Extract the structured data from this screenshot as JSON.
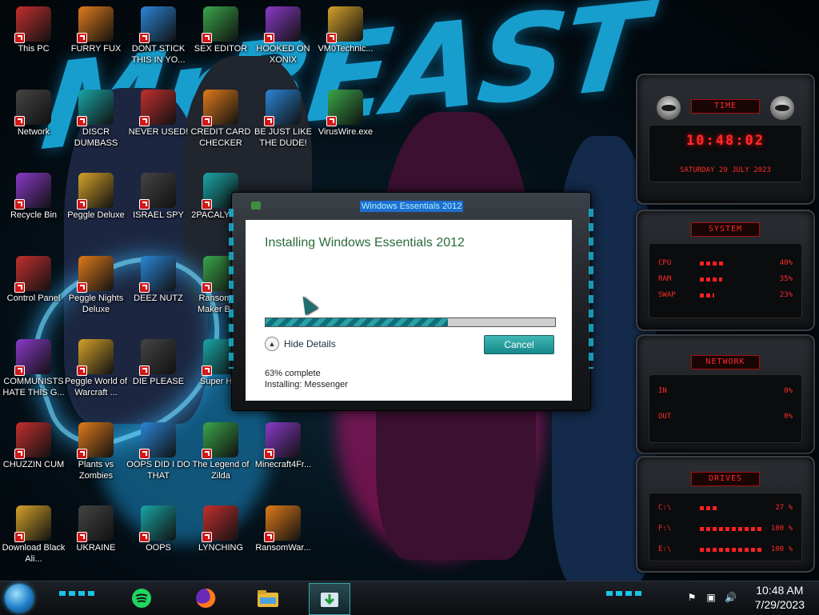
{
  "desktop": {
    "icons": [
      {
        "label": "This PC"
      },
      {
        "label": "FURRY FUX"
      },
      {
        "label": "DONT STICK THIS IN YO..."
      },
      {
        "label": "SEX EDITOR"
      },
      {
        "label": "HOOKED ON XONIX"
      },
      {
        "label": "VM0Technic..."
      },
      {
        "label": "Network"
      },
      {
        "label": "DISCR DUMBASS"
      },
      {
        "label": "NEVER USED!"
      },
      {
        "label": "CREDIT CARD CHECKER"
      },
      {
        "label": "BE JUST LIKE THE DUDE!"
      },
      {
        "label": "VirusWire.exe"
      },
      {
        "label": "Recycle Bin"
      },
      {
        "label": "Peggle Deluxe"
      },
      {
        "label": "ISRAEL SPY"
      },
      {
        "label": "2PACALYP 2.3"
      },
      {
        "label": "Control Panel"
      },
      {
        "label": "Peggle Nights Deluxe"
      },
      {
        "label": "DEEZ NUTZ"
      },
      {
        "label": "Ransomwa Maker Build"
      },
      {
        "label": "COMMUNISTS HATE THIS G..."
      },
      {
        "label": "Peggle World of Warcraft ..."
      },
      {
        "label": "DIE PLEASE"
      },
      {
        "label": "Super Hi..."
      },
      {
        "label": "CHUZZIN CUM"
      },
      {
        "label": "Plants vs Zombies"
      },
      {
        "label": "OOPS DID I DO THAT"
      },
      {
        "label": "The Legend of Zilda"
      },
      {
        "label": "Minecraft4Fr..."
      },
      {
        "label": "Download Black Ali..."
      },
      {
        "label": "UKRAINE"
      },
      {
        "label": "OOPS"
      },
      {
        "label": "LYNCHING"
      },
      {
        "label": "RansomWar..."
      }
    ]
  },
  "installer": {
    "title": "Windows Essentials 2012",
    "heading": "Installing Windows Essentials 2012",
    "progress_fraction": 0.63,
    "hide_details_label": "Hide Details",
    "cancel_label": "Cancel",
    "status_percent": "63% complete",
    "status_item": "Installing: Messenger"
  },
  "gadgets": {
    "clock": {
      "header": "TIME",
      "time": "10:48:02",
      "date": "SATURDAY 29 JULY 2023"
    },
    "system": {
      "header": "SYSTEM",
      "rows": [
        {
          "name": "CPU",
          "value": "40%",
          "fraction": 0.4
        },
        {
          "name": "RAM",
          "value": "35%",
          "fraction": 0.35
        },
        {
          "name": "SWAP",
          "value": "23%",
          "fraction": 0.23
        }
      ]
    },
    "network": {
      "header": "NETWORK",
      "rows": [
        {
          "name": "IN",
          "value": "0%"
        },
        {
          "name": "OUT",
          "value": "0%"
        }
      ]
    },
    "drives": {
      "header": "DRIVES",
      "rows": [
        {
          "name": "C:\\",
          "value": "27 %",
          "fraction": 0.27
        },
        {
          "name": "F:\\",
          "value": "100 %",
          "fraction": 1.0
        },
        {
          "name": "E:\\",
          "value": "100 %",
          "fraction": 1.0
        }
      ]
    }
  },
  "taskbar": {
    "pinned": [
      {
        "icon": "spotify-icon"
      },
      {
        "icon": "firefox-icon"
      },
      {
        "icon": "file-explorer-icon"
      },
      {
        "icon": "installer-icon"
      }
    ],
    "time": "10:48 AM",
    "date": "7/29/2023"
  }
}
